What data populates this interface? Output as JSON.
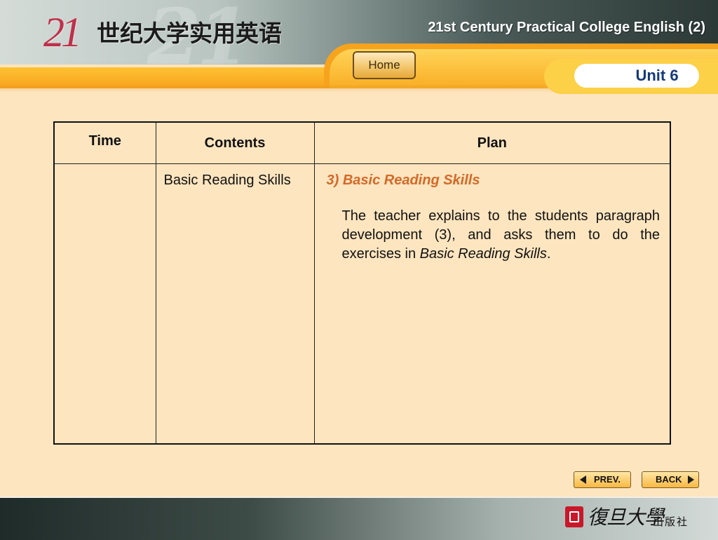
{
  "header": {
    "logo_number": "21",
    "logo_chinese": "世纪大学实用英语",
    "course_title": "21st Century Practical College English (2)"
  },
  "nav": {
    "home_label": "Home",
    "unit_label": "Unit 6"
  },
  "table": {
    "headers": [
      "Time",
      "Contents",
      "Plan"
    ],
    "rows": [
      {
        "time": "",
        "contents": "Basic Reading Skills",
        "plan_heading": "3) Basic Reading Skills",
        "plan_text_before": "The teacher explains to the students paragraph development (3), and asks them to do the exercises in ",
        "plan_text_emphasis": "Basic Reading Skills",
        "plan_text_after": "."
      }
    ]
  },
  "buttons": {
    "prev_label": "PREV.",
    "back_label": "BACK"
  },
  "footer": {
    "publisher_name": "復旦大學",
    "publisher_suffix": "出版社"
  },
  "colors": {
    "background": "#fde5bf",
    "accent_orange": "#f7a21e",
    "heading_orange": "#d26a2a",
    "unit_blue": "#163a78"
  }
}
